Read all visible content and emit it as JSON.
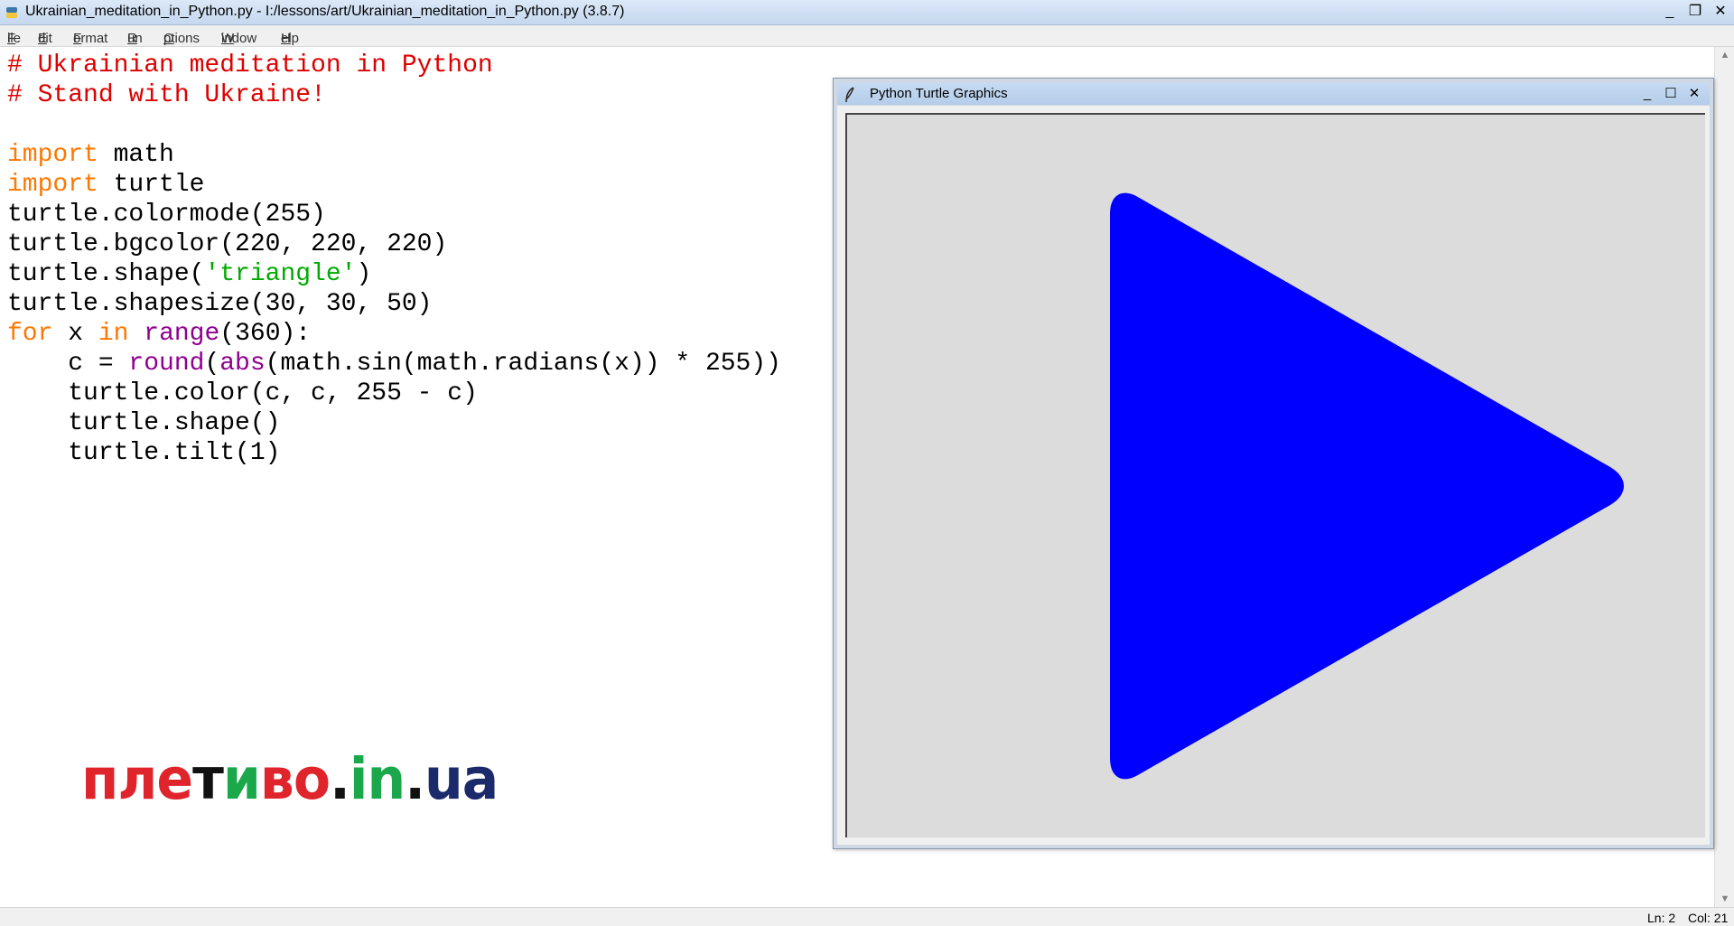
{
  "window": {
    "title": "Ukrainian_meditation_in_Python.py - I:/lessons/art/Ukrainian_meditation_in_Python.py (3.8.7)",
    "buttons": {
      "minimize": "_",
      "restore": "❐",
      "close": "✕"
    }
  },
  "menu": [
    {
      "label": "File",
      "underline": "F",
      "rest": "ile"
    },
    {
      "label": "Edit",
      "underline": "E",
      "rest": "dit"
    },
    {
      "label": "Format",
      "underline": "F",
      "rest": "ormat"
    },
    {
      "label": "Run",
      "underline": "R",
      "rest": "un"
    },
    {
      "label": "Options",
      "underline": "O",
      "rest": "ptions"
    },
    {
      "label": "Window",
      "underline": "W",
      "rest": "indow"
    },
    {
      "label": "Help",
      "underline": "H",
      "rest": "elp"
    }
  ],
  "code": {
    "l1": "# Ukrainian meditation in Python",
    "l2": "# Stand with Ukraine!",
    "l4_kw": "import",
    "l4_rest": " math",
    "l5_kw": "import",
    "l5_rest": " turtle",
    "l6": "turtle.colormode(255)",
    "l7": "turtle.bgcolor(220, 220, 220)",
    "l8_a": "turtle.shape(",
    "l8_str": "'triangle'",
    "l8_b": ")",
    "l9": "turtle.shapesize(30, 30, 50)",
    "l10_for": "for",
    "l10_x": " x ",
    "l10_in": "in",
    "l10_sp": " ",
    "l10_range": "range",
    "l10_rest": "(360):",
    "l11_a": "    c = ",
    "l11_round": "round",
    "l11_paren": "(",
    "l11_abs": "abs",
    "l11_rest": "(math.sin(math.radians(x)) * 255))",
    "l12": "    turtle.color(c, c, 255 - c)",
    "l13": "    turtle.shape()",
    "l14": "    turtle.tilt(1)"
  },
  "logo": {
    "p1": "пле",
    "p2": "т",
    "p3": "и",
    "p4": "во",
    "p5": ".",
    "p6": "in",
    "p7": ".",
    "p8": "ua",
    "colors": {
      "red": "#e0242b",
      "black": "#111111",
      "green": "#1aa84a",
      "darkblue": "#1b2a6b"
    }
  },
  "turtle_window": {
    "title": "Python Turtle Graphics",
    "buttons": {
      "minimize": "_",
      "maximize": "☐",
      "close": "✕"
    },
    "canvas_bg": "#dcdcdc",
    "shape": "triangle",
    "shape_color": "#0000ff"
  },
  "status": {
    "ln": "Ln: 2",
    "col": "Col: 21"
  },
  "colors": {
    "comment": "#dd0000",
    "keyword": "#ff7700",
    "builtin": "#900090",
    "string": "#00aa00"
  }
}
